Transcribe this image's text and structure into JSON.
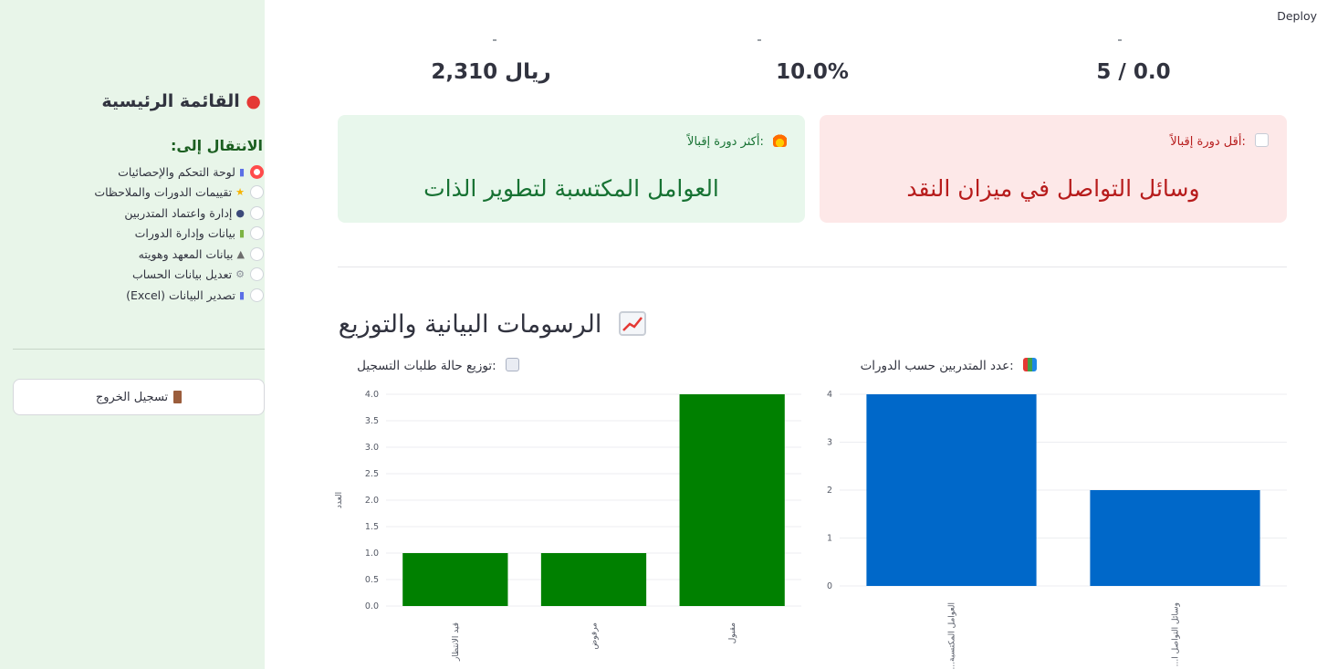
{
  "header": {
    "deploy_label": "Deploy"
  },
  "metrics": [
    {
      "value": "2,310 ريال"
    },
    {
      "value": "10.0%"
    },
    {
      "value": "5 / 0.0"
    }
  ],
  "sidebar": {
    "title": "القائمة الرئيسية",
    "title_icon": "pin-icon",
    "nav_label": "الانتقال إلى:",
    "items": [
      {
        "label": "لوحة التحكم والإحصائيات",
        "icon": "bar-chart-icon",
        "selected": true
      },
      {
        "label": "تقييمات الدورات والملاحظات",
        "icon": "star-icon",
        "selected": false
      },
      {
        "label": "إدارة واعتماد المتدربين",
        "icon": "users-icon",
        "selected": false
      },
      {
        "label": "بيانات وإدارة الدورات",
        "icon": "books-icon",
        "selected": false
      },
      {
        "label": "بيانات المعهد وهويته",
        "icon": "institution-icon",
        "selected": false
      },
      {
        "label": "تعديل بيانات الحساب",
        "icon": "gear-icon",
        "selected": false
      },
      {
        "label": "تصدير البيانات (Excel)",
        "icon": "bar-chart-icon",
        "selected": false
      }
    ],
    "logout_label": "تسجيل الخروج",
    "accent_color": "#ff4b4b"
  },
  "alerts": {
    "most": {
      "label": ":أكثر دورة إقبالاً",
      "value": "العوامل المكتسبة لتطوير الذات",
      "icon": "fire-icon",
      "color": "#177233"
    },
    "least": {
      "label": ":أقل دورة إقبالاً",
      "value": "وسائل التواصل في ميزان النقد",
      "icon": "chart-down-icon",
      "color": "#b71c1c"
    }
  },
  "section": {
    "title": "الرسومات البيانية والتوزيع"
  },
  "chart_data": [
    {
      "type": "bar",
      "title": ":توزيع حالة طلبات التسجيل",
      "categories": [
        "قيد الانتظار",
        "مرفوض",
        "مقبول"
      ],
      "values": [
        1,
        1,
        4
      ],
      "ylabel": "العدد",
      "ylim": [
        0,
        4
      ],
      "yticks": [
        "0.0",
        "0.5",
        "1.0",
        "1.5",
        "2.0",
        "2.5",
        "3.0",
        "3.5",
        "4.0"
      ],
      "color": "#008000"
    },
    {
      "type": "bar",
      "title": ":عدد المتدربين حسب الدورات",
      "categories": [
        "...العوامل المكتسبة",
        "...وسائل التواصل ا"
      ],
      "values": [
        4,
        2
      ],
      "ylim": [
        0,
        4
      ],
      "yticks": [
        "0",
        "1",
        "2",
        "3",
        "4"
      ],
      "color": "#0068c9"
    }
  ]
}
